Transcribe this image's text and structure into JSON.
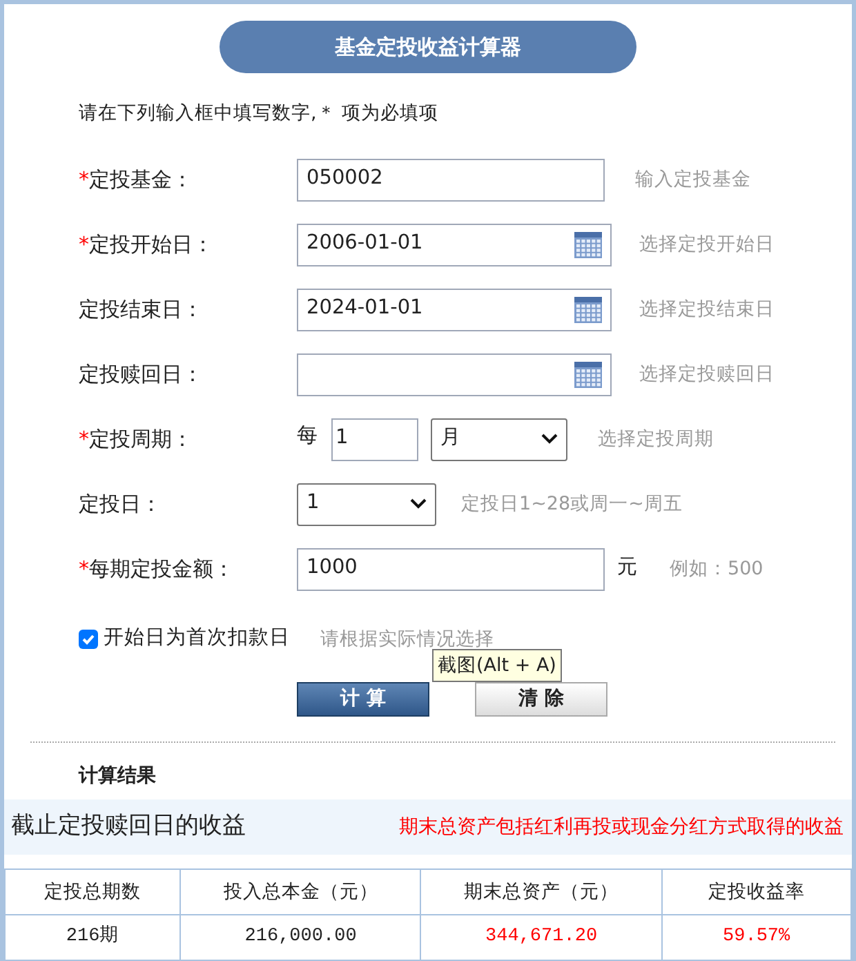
{
  "title": "基金定投收益计算器",
  "instruction": "请在下列输入框中填写数字,＊ 项为必填项",
  "fields": [
    {
      "kind": "text",
      "required_mark": "*",
      "label": "定投基金：",
      "value": "050002",
      "hint": "输入定投基金"
    },
    {
      "kind": "date",
      "required_mark": "*",
      "label": "定投开始日：",
      "value": "2006-01-01",
      "hint": "选择定投开始日"
    },
    {
      "kind": "date",
      "label": "定投结束日：",
      "value": "2024-01-01",
      "hint": "选择定投结束日"
    },
    {
      "kind": "date",
      "label": "定投赎回日：",
      "hint": "选择定投赎回日"
    },
    {
      "kind": "period",
      "required_mark": "*",
      "label": "定投周期：",
      "prefix": "每",
      "value": "1",
      "unit": "月",
      "hint": "选择定投周期"
    },
    {
      "kind": "select",
      "label": "定投日：",
      "value": "1",
      "hint": "定投日1~28或周一~周五"
    },
    {
      "kind": "amount",
      "required_mark": "*",
      "label": "每期定投金额：",
      "value": "1000",
      "unit": "元",
      "hint": "例如：500"
    }
  ],
  "checkbox": {
    "label": "开始日为首次扣款日",
    "checked": true,
    "hint": "请根据实际情况选择"
  },
  "tooltip": "截图(Alt + A)",
  "buttons": [
    {
      "label": "计 算",
      "kind": "primary"
    },
    {
      "label": "清 除",
      "kind": "secondary"
    }
  ],
  "results": {
    "heading": "计算结果",
    "banner_title": "截止定投赎回日的收益",
    "banner_note": "期末总资产包括红利再投或现金分红方式取得的收益",
    "columns": [
      "定投总期数",
      "投入总本金（元）",
      "期末总资产（元）",
      "定投收益率"
    ],
    "rows": [
      [
        {
          "text": "216期",
          "highlight": false
        },
        {
          "text": "216,000.00",
          "highlight": false
        },
        {
          "text": "344,671.20",
          "highlight": true
        },
        {
          "text": "59.57%",
          "highlight": true
        }
      ]
    ]
  }
}
